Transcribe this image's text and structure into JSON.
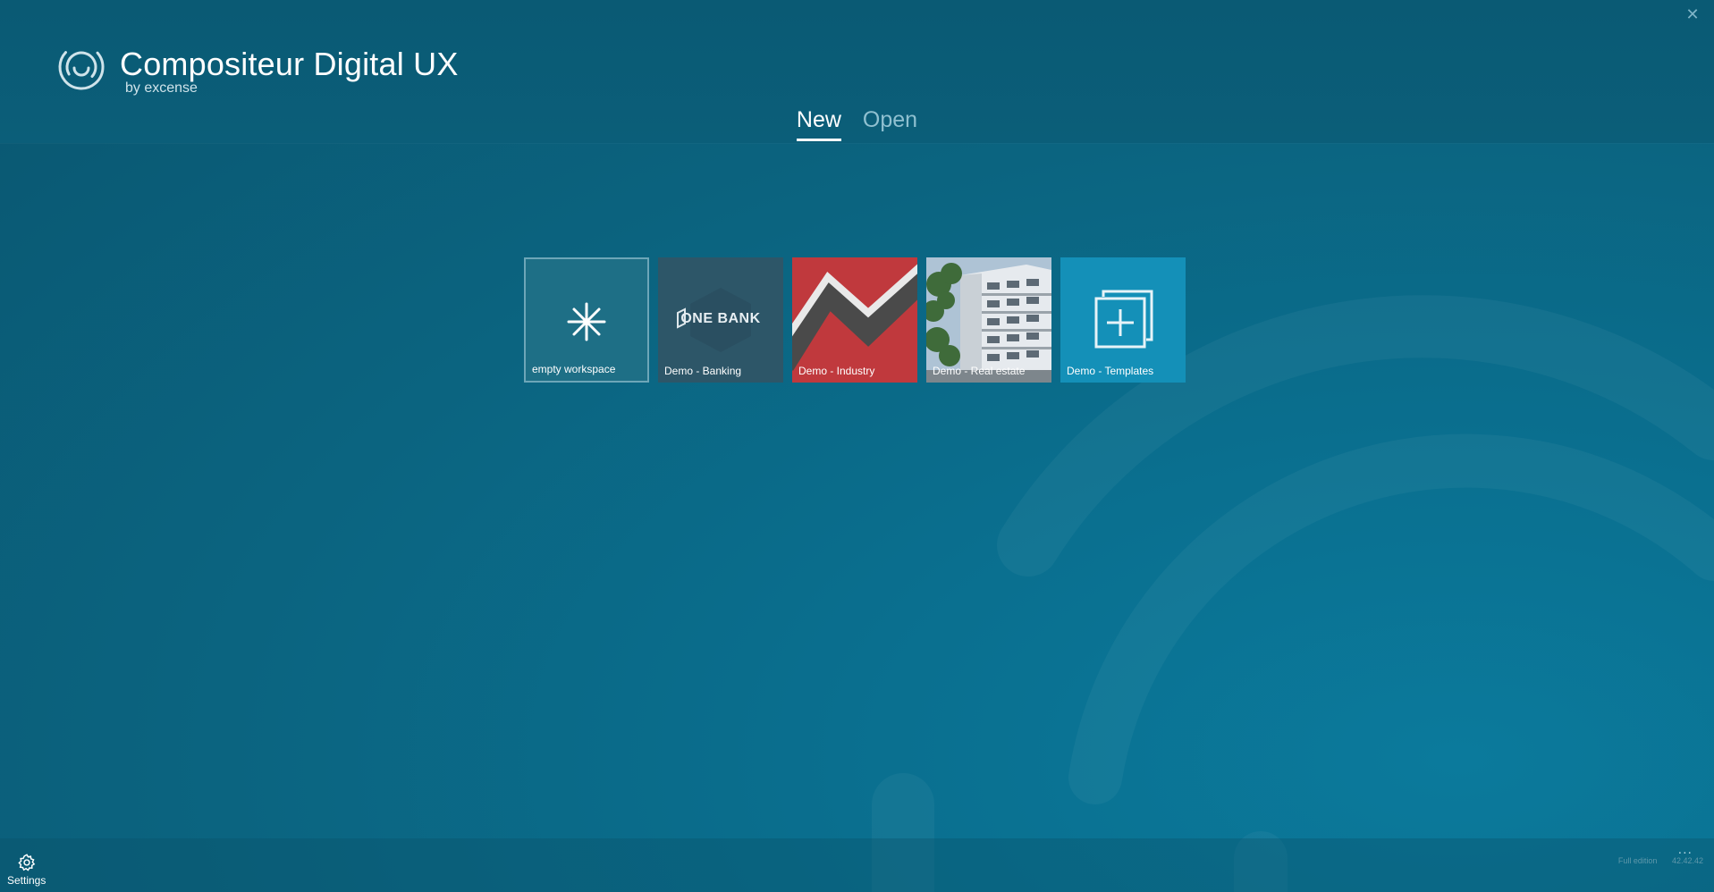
{
  "window": {
    "close_icon": "close-icon"
  },
  "brand": {
    "title": "Compositeur Digital UX",
    "byline": "by excense",
    "logo_icon": "compositeur-logo-icon"
  },
  "tabs": [
    {
      "label": "New",
      "active": true
    },
    {
      "label": "Open",
      "active": false
    }
  ],
  "tiles": [
    {
      "label": "empty workspace",
      "icon": "asterisk-icon"
    },
    {
      "label": "Demo - Banking",
      "logo_text": "ONE BANK",
      "icon": "one-bank-logo-icon"
    },
    {
      "label": "Demo - Industry",
      "icon": "industry-zigzag-image"
    },
    {
      "label": "Demo - Real estate",
      "icon": "building-photo-image"
    },
    {
      "label": "Demo - Templates",
      "icon": "add-template-icon"
    }
  ],
  "footer": {
    "settings_label": "Settings",
    "settings_icon": "gear-icon",
    "more_label": "...",
    "edition": "Full edition",
    "version": "42.42.42"
  },
  "colors": {
    "background": "#0b6480",
    "header": "#0a5a74",
    "accent_tab": "#ffffff",
    "inactive_tab": "#8fc0d0",
    "industry_red": "#c0393d",
    "templates_blue": "#1490b8"
  }
}
